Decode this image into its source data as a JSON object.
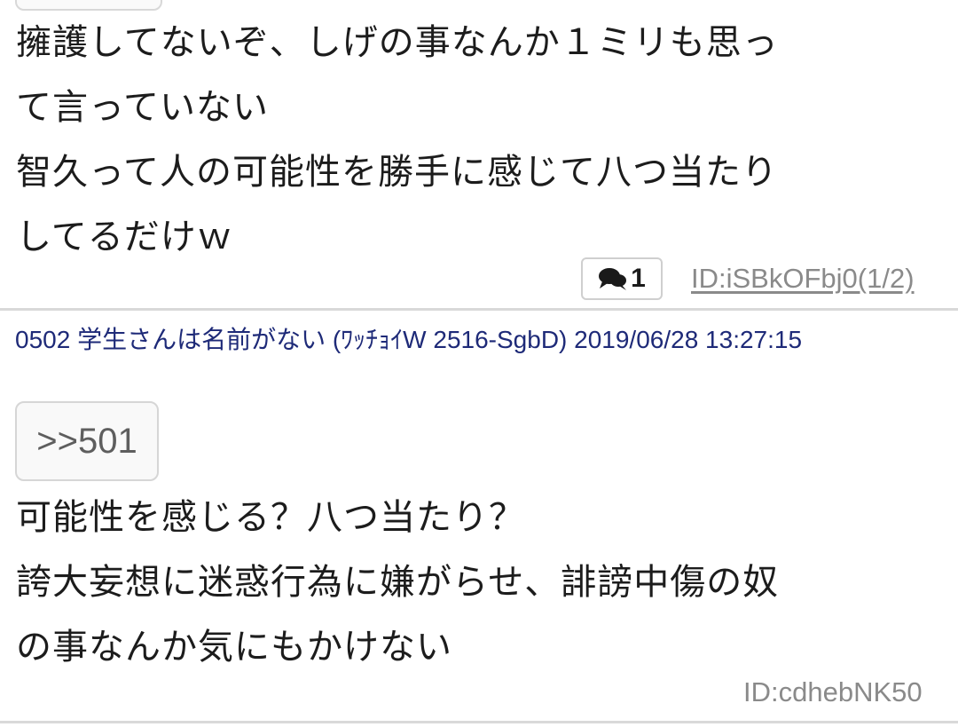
{
  "post_previous": {
    "body_lines": [
      "擁護してないぞ、しげの事なんか１ミリも思っ",
      "て言っていない",
      "智久って人の可能性を勝手に感じて八つ当たり",
      "してるだけｗ"
    ],
    "reply_count": "1",
    "id_text": "ID:iSBkOFbj0(1/2)"
  },
  "post_502": {
    "header": "0502 学生さんは名前がない (ﾜｯﾁｮｲW 2516-SgbD) 2019/06/28 13:27:15",
    "anchor": ">>501",
    "body_lines": [
      "可能性を感じる？八つ当たり？",
      "誇大妄想に迷惑行為に嫌がらせ、誹謗中傷の奴",
      "の事なんか気にもかけない"
    ],
    "id_text": "ID:cdhebNK50"
  },
  "icons": {
    "reply_badge_icon": "speech-bubbles-icon"
  }
}
